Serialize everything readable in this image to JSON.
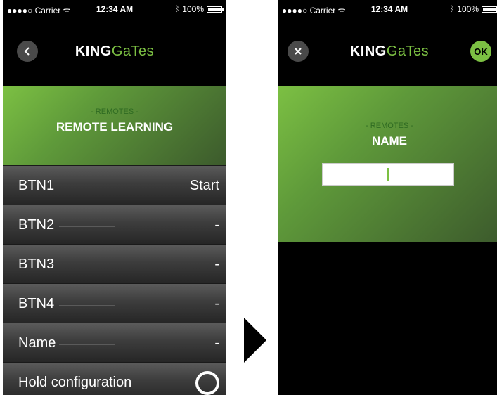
{
  "left": {
    "status": {
      "carrier": "●●●●○ Carrier ᯤ",
      "time": "12:34 AM",
      "battery": "100%"
    },
    "logo": {
      "bold": "KING",
      "light": "GaTes"
    },
    "hero": {
      "subtitle": "- REMOTES -",
      "title": "REMOTE LEARNING"
    },
    "rows": [
      {
        "label": "BTN1",
        "value": "Start"
      },
      {
        "label": "BTN2",
        "value": "-"
      },
      {
        "label": "BTN3",
        "value": "-"
      },
      {
        "label": "BTN4",
        "value": "-"
      },
      {
        "label": "Name",
        "value": "-"
      },
      {
        "label": "Hold configuration",
        "value": ""
      }
    ]
  },
  "right": {
    "status": {
      "carrier": "●●●●○ Carrier ᯤ",
      "time": "12:34 AM",
      "battery": "100%"
    },
    "logo": {
      "bold": "KING",
      "light": "GaTes"
    },
    "ok_label": "OK",
    "hero": {
      "subtitle": "- REMOTES -",
      "title": "NAME"
    },
    "input": {
      "value": ""
    }
  },
  "icons": {
    "back": "back-chevron-icon",
    "close": "close-icon",
    "bluetooth": "bluetooth-icon",
    "arrow": "next-arrow-icon"
  },
  "colors": {
    "accent": "#7cc043",
    "background": "#000000"
  }
}
